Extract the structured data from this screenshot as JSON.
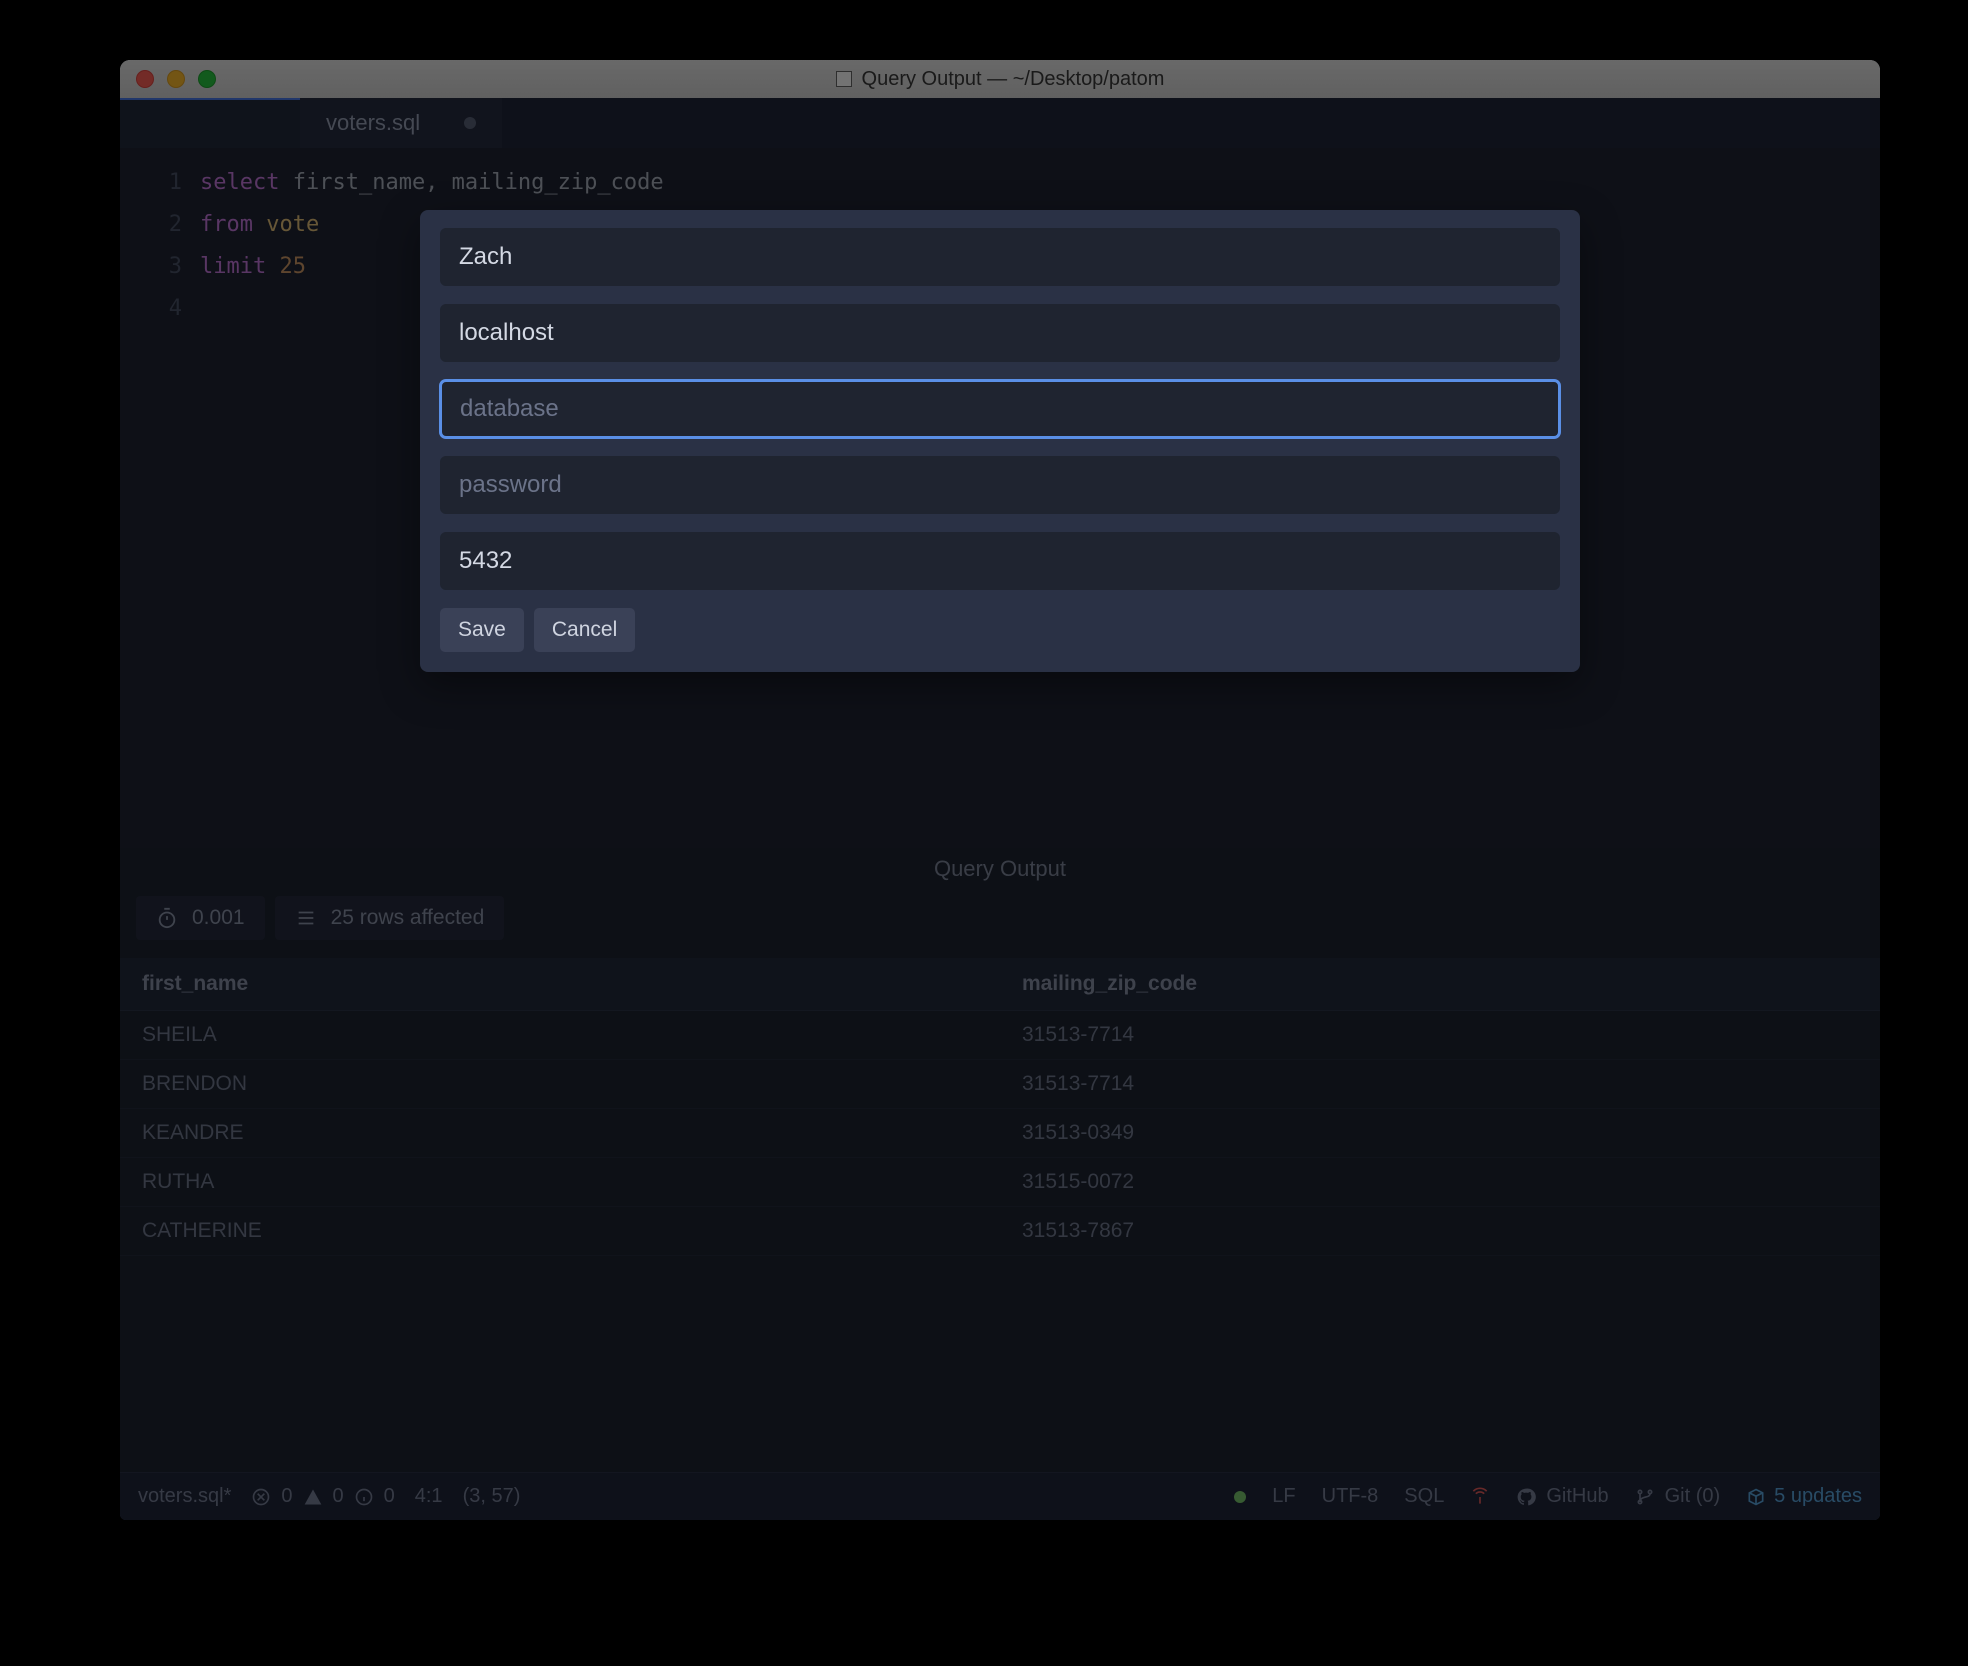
{
  "window": {
    "title": "Query Output — ~/Desktop/patom"
  },
  "tabs": [
    {
      "label": "voters.sql",
      "modified": true
    }
  ],
  "editor": {
    "gutter": [
      "1",
      "2",
      "3",
      "4"
    ],
    "tokens": {
      "l1": {
        "a": "select",
        "b": "first_name, mailing_zip_code"
      },
      "l2": {
        "a": "from",
        "b": "vote"
      },
      "l3": {
        "a": "limit",
        "b": "25"
      }
    }
  },
  "dialog": {
    "fields": {
      "username": "Zach",
      "host": "localhost",
      "database_placeholder": "database",
      "password_placeholder": "password",
      "port": "5432"
    },
    "buttons": {
      "save": "Save",
      "cancel": "Cancel"
    }
  },
  "output": {
    "title": "Query Output",
    "time": "0.001",
    "rows_affected": "25 rows affected",
    "columns": [
      "first_name",
      "mailing_zip_code"
    ],
    "rows": [
      {
        "first_name": "SHEILA",
        "mailing_zip_code": "31513-7714"
      },
      {
        "first_name": "BRENDON",
        "mailing_zip_code": "31513-7714"
      },
      {
        "first_name": "KEANDRE",
        "mailing_zip_code": "31513-0349"
      },
      {
        "first_name": "RUTHA",
        "mailing_zip_code": "31515-0072"
      },
      {
        "first_name": "CATHERINE",
        "mailing_zip_code": "31513-7867"
      }
    ]
  },
  "status": {
    "filename": "voters.sql*",
    "errors": "0",
    "warnings": "0",
    "infos": "0",
    "cursor": "4:1",
    "selection": "(3, 57)",
    "line_ending": "LF",
    "encoding": "UTF-8",
    "grammar": "SQL",
    "github": "GitHub",
    "git": "Git (0)",
    "updates": "5 updates"
  }
}
